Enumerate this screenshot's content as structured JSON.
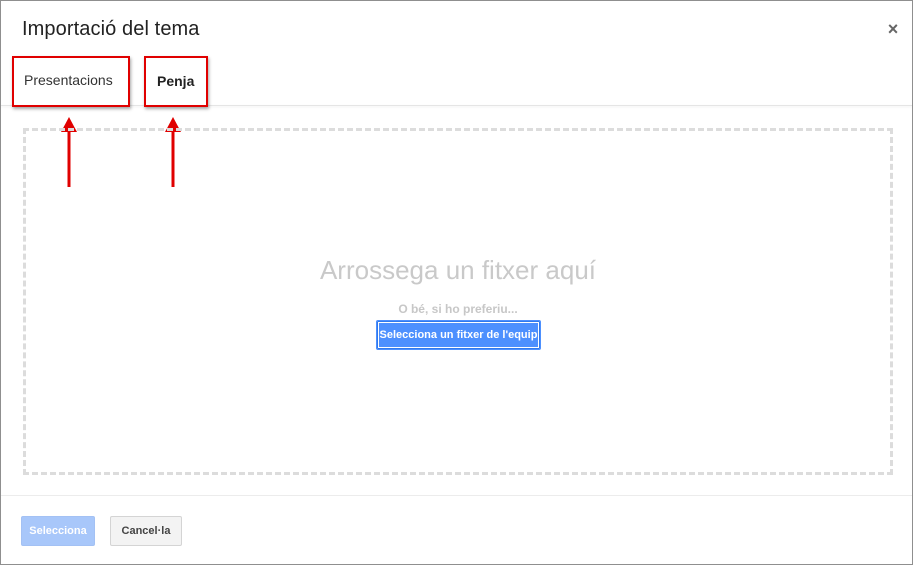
{
  "dialog": {
    "title": "Importació del tema",
    "close_label": "×"
  },
  "tabs": [
    {
      "label": "Presentacions",
      "active": false
    },
    {
      "label": "Penja",
      "active": true
    }
  ],
  "dropzone": {
    "title": "Arrossega un fitxer aquí",
    "alternative": "O bé, si ho preferiu...",
    "select_button_label": "Selecciona un fitxer de l'equip"
  },
  "footer": {
    "select_label": "Selecciona",
    "cancel_label": "Cancel·la"
  },
  "colors": {
    "annotation": "#e00000",
    "primary": "#4d90fe",
    "primary_disabled": "#a8c7fa"
  }
}
